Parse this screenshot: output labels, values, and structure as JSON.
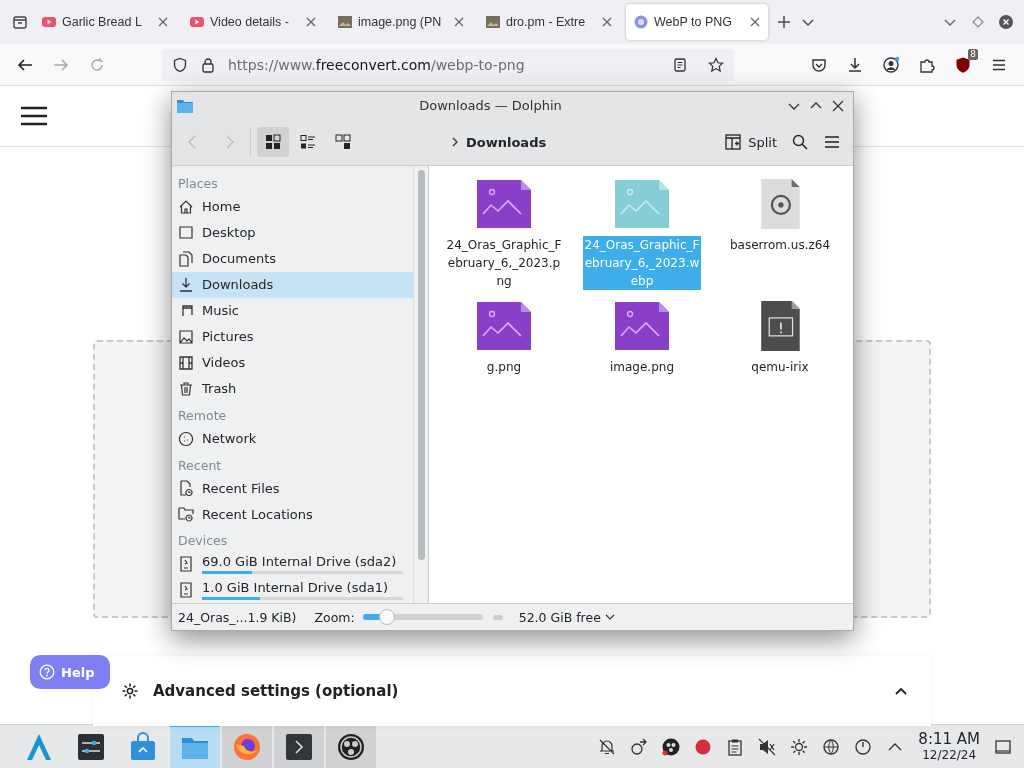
{
  "browser": {
    "tabs": [
      {
        "title": "Garlic Bread L",
        "kind": "video",
        "selected": false
      },
      {
        "title": "Video details -",
        "kind": "video",
        "selected": false
      },
      {
        "title": "image.png (PN",
        "kind": "image",
        "selected": false
      },
      {
        "title": "dro.pm - Extre",
        "kind": "image",
        "selected": false
      },
      {
        "title": "WebP to PNG",
        "kind": "converter",
        "selected": true
      }
    ],
    "url": {
      "scheme": "https://www.",
      "domain": "freeconvert.com",
      "path": "/webp-to-png"
    },
    "extension_badge": "8"
  },
  "page": {
    "help": "Help",
    "advanced_settings": "Advanced settings (optional)"
  },
  "dolphin": {
    "title": "Downloads — Dolphin",
    "view_modes": [
      {
        "kind": "icons",
        "selected": true
      },
      {
        "kind": "compact",
        "selected": false
      },
      {
        "kind": "details",
        "selected": false
      }
    ],
    "breadcrumb": "Downloads",
    "split": "Split",
    "sidebar": [
      {
        "heading": "Places",
        "items": [
          {
            "label": "Home",
            "kind": "home",
            "selected": false
          },
          {
            "label": "Desktop",
            "kind": "desktop",
            "selected": false
          },
          {
            "label": "Documents",
            "kind": "documents",
            "selected": false
          },
          {
            "label": "Downloads",
            "kind": "download",
            "selected": true
          },
          {
            "label": "Music",
            "kind": "music",
            "selected": false
          },
          {
            "label": "Pictures",
            "kind": "pictures",
            "selected": false
          },
          {
            "label": "Videos",
            "kind": "videos",
            "selected": false
          },
          {
            "label": "Trash",
            "kind": "trash",
            "selected": false
          }
        ]
      },
      {
        "heading": "Remote",
        "items": [
          {
            "label": "Network",
            "kind": "network",
            "selected": false
          }
        ]
      },
      {
        "heading": "Recent",
        "items": [
          {
            "label": "Recent Files",
            "kind": "recent-file",
            "selected": false
          },
          {
            "label": "Recent Locations",
            "kind": "recent-folder",
            "selected": false
          }
        ]
      },
      {
        "heading": "Devices",
        "items": [
          {
            "label": "69.0 GiB Internal Drive (sda2)",
            "kind": "drive",
            "selected": false,
            "level": 0.25
          },
          {
            "label": "1.0 GiB Internal Drive (sda1)",
            "kind": "drive",
            "selected": false,
            "level": 0.29
          }
        ]
      }
    ],
    "files": [
      {
        "name": "24_Oras_Graphic_February_6,_2023.png",
        "kind": "image",
        "selected": false
      },
      {
        "name": "24_Oras_Graphic_February_6,_2023.webp",
        "kind": "image",
        "selected": true
      },
      {
        "name": "baserrom.us.z64",
        "kind": "disc",
        "selected": false
      },
      {
        "name": "g.png",
        "kind": "image",
        "selected": false
      },
      {
        "name": "image.png",
        "kind": "image",
        "selected": false
      },
      {
        "name": "qemu-irix",
        "kind": "executable",
        "selected": false
      }
    ],
    "status": {
      "selection": "24_Oras_...1.9 KiB)",
      "zoom_label": "Zoom:",
      "zoom": {
        "level": 0.2
      },
      "free_space": "52.0 GiB free"
    }
  },
  "taskbar": {
    "apps": [
      {
        "kind": "launcher",
        "selected": false,
        "running": false
      },
      {
        "kind": "settings",
        "selected": false,
        "running": false
      },
      {
        "kind": "store",
        "selected": false,
        "running": false
      },
      {
        "kind": "files",
        "selected": true
      },
      {
        "kind": "browser",
        "selected": false,
        "running": true
      },
      {
        "kind": "terminal",
        "selected": false,
        "running": true
      },
      {
        "kind": "recorder",
        "selected": false,
        "running": true
      }
    ],
    "time": "8:11 AM",
    "date": "12/22/24"
  }
}
